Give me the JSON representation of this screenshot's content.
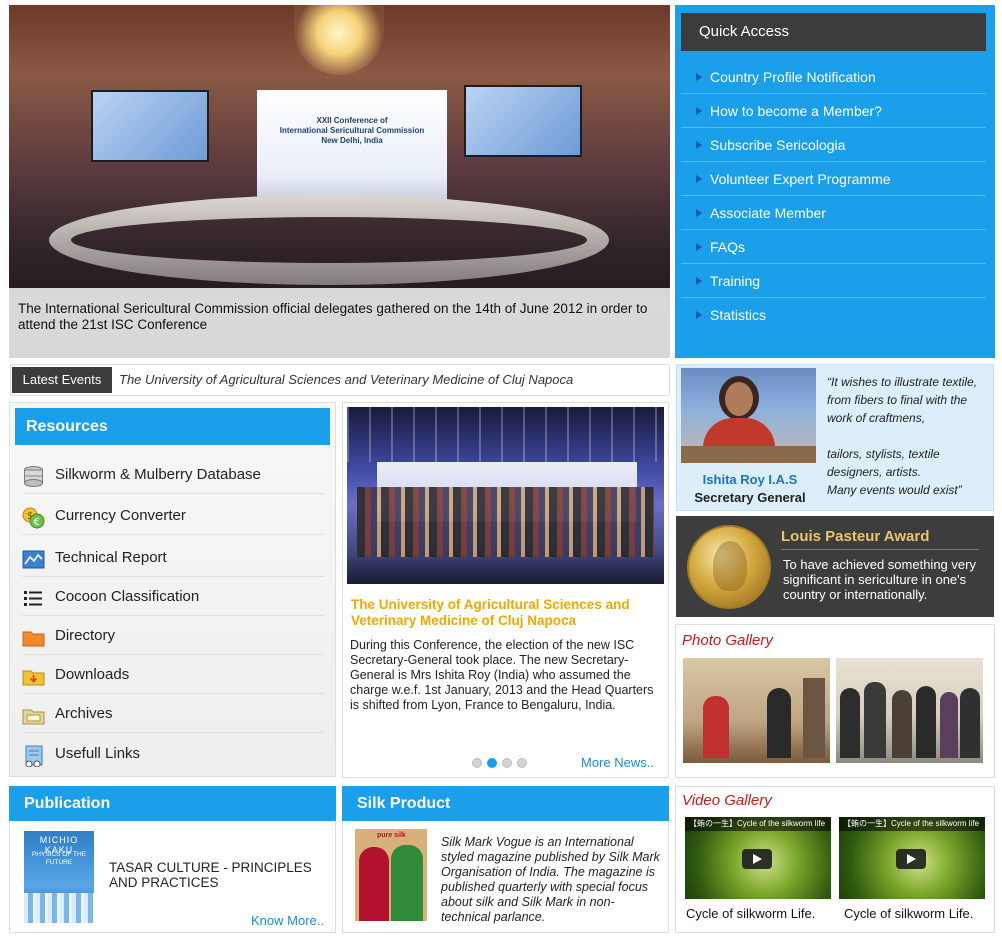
{
  "hero": {
    "caption": "The International Sericultural Commission official delegates gathered on the 14th of June 2012 in order to attend the 21st ISC Conference",
    "backdrop_line1": "XXII Conference of",
    "backdrop_line2": "International Sericultural Commission",
    "backdrop_line3": "New Delhi, India"
  },
  "quick_access": {
    "title": "Quick Access",
    "items": [
      {
        "label": "Country Profile Notification"
      },
      {
        "label": "How to become a Member?"
      },
      {
        "label": "Subscribe Sericologia"
      },
      {
        "label": "Volunteer Expert Programme"
      },
      {
        "label": "Associate Member"
      },
      {
        "label": "FAQs"
      },
      {
        "label": "Training"
      },
      {
        "label": "Statistics"
      }
    ]
  },
  "latest_events": {
    "label": "Latest Events",
    "text": "The University of Agricultural Sciences and Veterinary Medicine of Cluj Napoca"
  },
  "secretary": {
    "name": "Ishita Roy I.A.S",
    "role": "Secretary General",
    "quote": "“It wishes to illustrate textile, from fibers to final with the work of craftmens,\n\ntailors, stylists, textile designers, artists.\nMany events would exist”"
  },
  "resources": {
    "title": "Resources",
    "items": [
      {
        "label": "Silkworm & Mulberry Database",
        "icon": "database-icon"
      },
      {
        "label": "Currency Converter",
        "icon": "currency-icon"
      },
      {
        "label": "Technical Report",
        "icon": "report-icon"
      },
      {
        "label": "Cocoon Classification",
        "icon": "list-icon"
      },
      {
        "label": "Directory",
        "icon": "folder-icon"
      },
      {
        "label": "Downloads",
        "icon": "downloads-folder-icon"
      },
      {
        "label": "Archives",
        "icon": "archive-icon"
      },
      {
        "label": "Usefull Links",
        "icon": "links-icon"
      }
    ]
  },
  "news": {
    "headline": "The University of Agricultural Sciences and Veterinary Medicine of Cluj Napoca",
    "body": "During this Conference, the election of the new ISC Secretary-General took place.  The new Secretary-General is Mrs Ishita Roy (India) who assumed the charge w.e.f. 1st January, 2013 and the Head Quarters is shifted from Lyon, France to Bengaluru, India.",
    "more": "More News..",
    "slides": 4,
    "active_slide": 2
  },
  "award": {
    "title": "Louis Pasteur Award",
    "text": "To have achieved something very significant in sericulture in one's country or internationally."
  },
  "photo_gallery": {
    "title": "Photo Gallery"
  },
  "publication": {
    "title": "Publication",
    "book_author": "MICHIO KAKU",
    "book_title": "PHYSICS OF THE FUTURE",
    "text": "TASAR CULTURE - PRINCIPLES AND PRACTICES",
    "more": "Know More.."
  },
  "silk_product": {
    "title": "Silk Product",
    "brand": "pure silk",
    "text": "Silk Mark Vogue is an International styled magazine published by Silk Mark Organisation of India. The magazine is published quarterly with special focus about silk and Silk Mark in non- technical parlance."
  },
  "video_gallery": {
    "title": "Video Gallery",
    "videos": [
      {
        "bar": "【蛕の一生】Cycle of the silkworm life",
        "caption": "Cycle of silkworm Life."
      },
      {
        "bar": "【蛕の一生】Cycle of the silkworm life",
        "caption": "Cycle of silkworm Life."
      }
    ]
  },
  "colors": {
    "accent_blue": "#1c9fea",
    "dark_bar": "#3c3c3c",
    "headline_gold": "#f0a800",
    "gallery_red": "#c51a1a"
  }
}
